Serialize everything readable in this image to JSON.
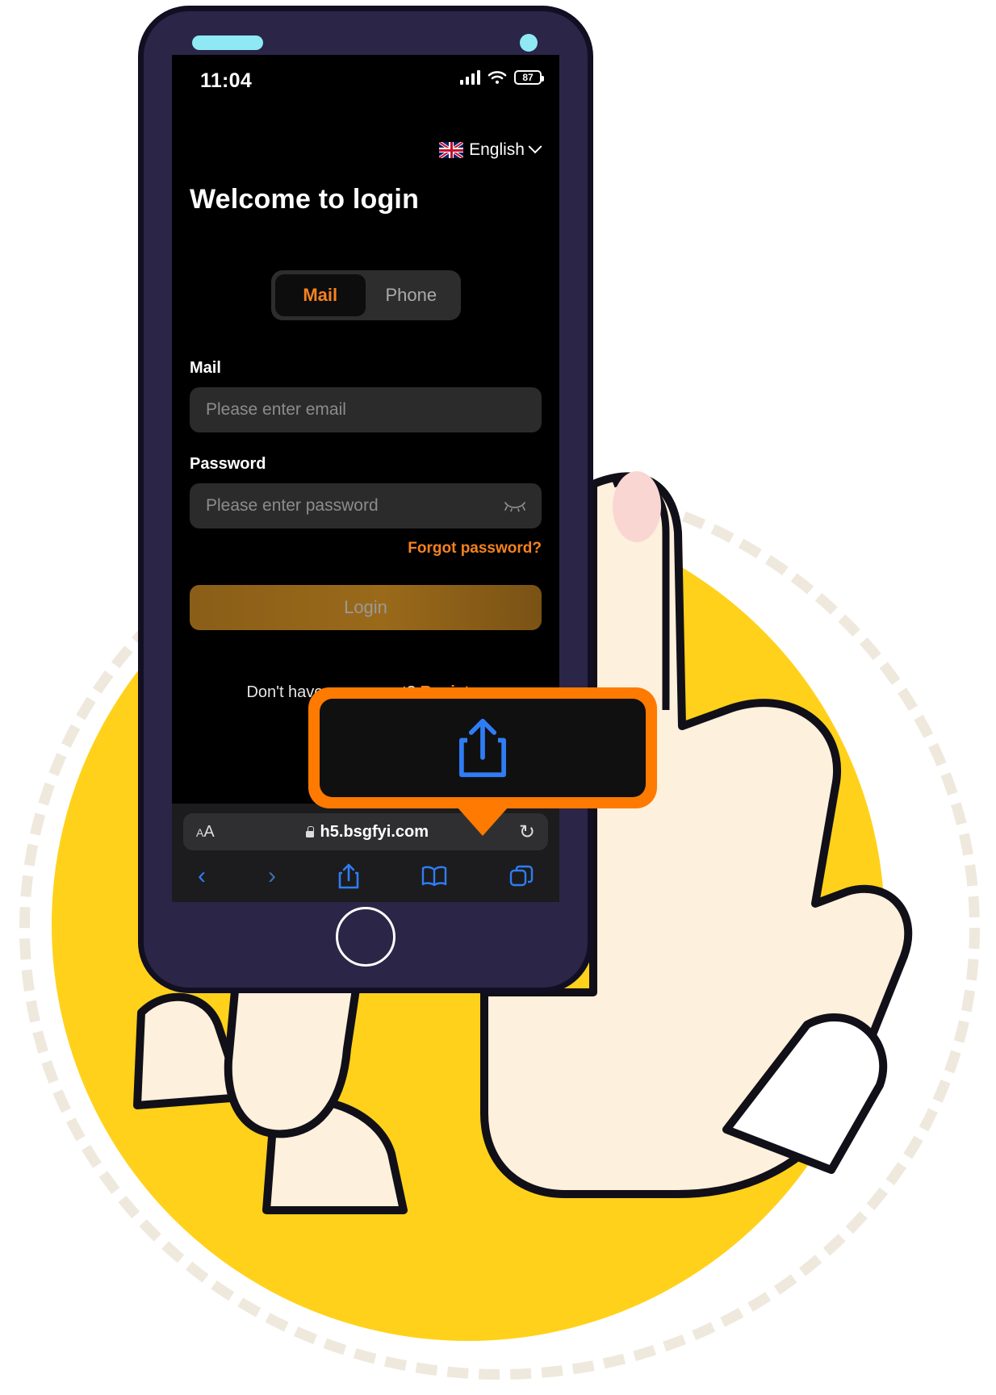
{
  "device": {
    "status_bar": {
      "time": "11:04",
      "signal_icon": "cellular-signal-icon",
      "wifi_icon": "wifi-icon",
      "battery_icon": "battery-icon",
      "battery_level": "87"
    }
  },
  "page": {
    "language_selector": {
      "flag_icon": "uk-flag-icon",
      "label": "English",
      "chevron_icon": "chevron-down-icon"
    },
    "title": "Welcome to login",
    "tabs": [
      {
        "label": "Mail",
        "active": true
      },
      {
        "label": "Phone",
        "active": false
      }
    ],
    "fields": [
      {
        "label": "Mail",
        "placeholder": "Please enter email",
        "value": ""
      },
      {
        "label": "Password",
        "placeholder": "Please enter password",
        "value": ""
      }
    ],
    "password_toggle_icon": "eye-off-icon",
    "forgot_password_label": "Forgot password?",
    "login_button_label": "Login",
    "signup_prompt": "Don't have an account?",
    "signup_link_label": "Register",
    "colors": {
      "accent": "#f5821f",
      "screen_bg": "#000000",
      "input_bg": "#2b2b2b",
      "login_button": "#8a5e18"
    }
  },
  "browser": {
    "name": "safari",
    "url_bar": {
      "text_size_label": "AA",
      "text_size_icon": "text-size-icon",
      "lock_icon": "lock-icon",
      "url": "h5.bsgfyi.com",
      "reload_icon": "reload-icon"
    },
    "toolbar": [
      {
        "name": "back",
        "icon": "chevron-left-icon",
        "glyph": "‹",
        "enabled": true
      },
      {
        "name": "forward",
        "icon": "chevron-right-icon",
        "glyph": "›",
        "enabled": false
      },
      {
        "name": "share",
        "icon": "share-icon",
        "glyph": "",
        "enabled": true
      },
      {
        "name": "bookmarks",
        "icon": "book-icon",
        "glyph": "",
        "enabled": true
      },
      {
        "name": "tabs",
        "icon": "tabs-icon",
        "glyph": "",
        "enabled": true
      }
    ]
  },
  "callout": {
    "highlight_icon": "share-icon",
    "accent_color": "#ff7a00"
  },
  "illustration": {
    "disc_color": "#ffd11a",
    "ring_color": "#efe9dd",
    "hand_icon": "hand-holding-phone-illustration"
  }
}
